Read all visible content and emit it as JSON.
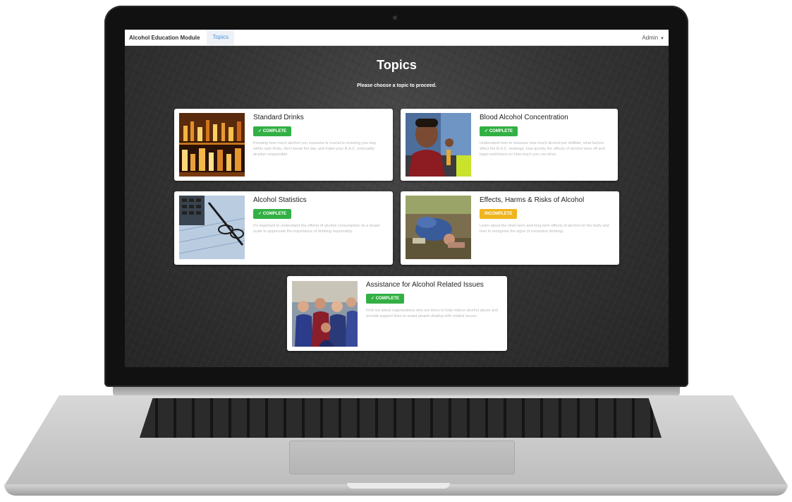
{
  "navbar": {
    "brand": "Alcohol Education Module",
    "active_link": "Topics",
    "user_menu": "Admin"
  },
  "page": {
    "title": "Topics",
    "subtitle": "Please choose a topic to proceed."
  },
  "topics": [
    {
      "title": "Standard Drinks",
      "status": "✓ COMPLETE",
      "description": "Knowing how much alcohol you consume is crucial to ensuring you stay within safe limits, don't break the law, and make your B.A.C. noticeably drunker responsible."
    },
    {
      "title": "Blood Alcohol Concentration",
      "status": "✓ COMPLETE",
      "description": "Understand how to measure how much alcohol per milliliter, what factors affect the B.A.C. readings, how quickly the effects of alcohol wear off and legal restrictions on how much you can drive."
    },
    {
      "title": "Alcohol Statistics",
      "status": "✓ COMPLETE",
      "description": "It's important to understand the effects of alcohol consumption on a broad scale to appreciate the importance of drinking responsibly."
    },
    {
      "title": "Effects, Harms & Risks of Alcohol",
      "status": "INCOMPLETE",
      "description": "Learn about the short term and long term effects of alcohol on the body and how to recognise the signs of excessive drinking."
    },
    {
      "title": "Assistance for Alcohol Related Issues",
      "status": "✓ COMPLETE",
      "description": "Find out about organisations who are there to help reduce alcohol abuse and provide support lines to assist people dealing with related issues."
    }
  ],
  "colors": {
    "complete": "#33b044",
    "incomplete": "#f0b41d",
    "nav_link": "#4a8fd6"
  }
}
